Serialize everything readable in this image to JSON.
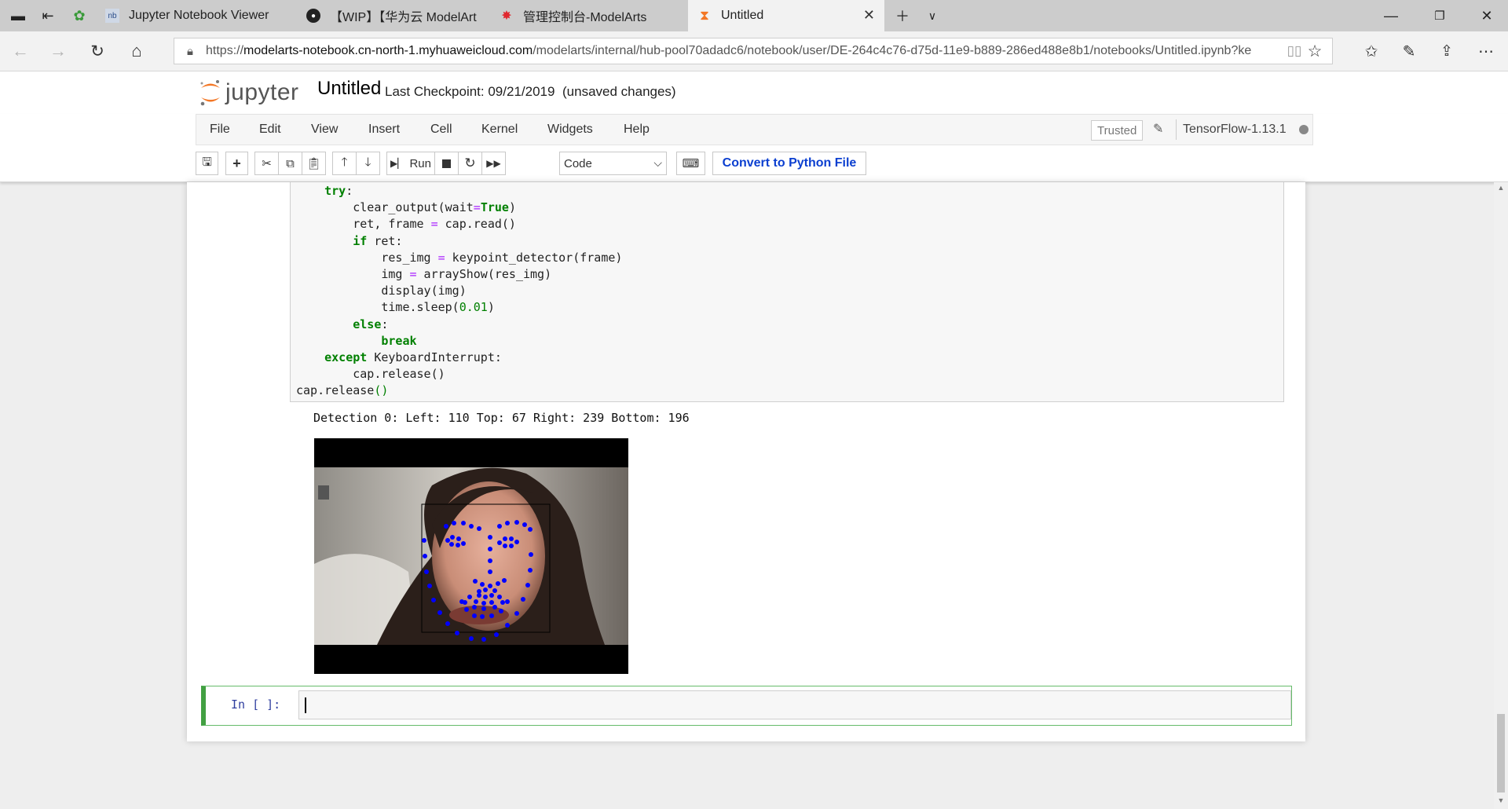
{
  "browser": {
    "tabs": [
      {
        "label": "Jupyter Notebook Viewer",
        "icon": "nbviewer-icon"
      },
      {
        "label": "【WIP】【华为云 ModelArt",
        "icon": "github-icon"
      },
      {
        "label": "管理控制台-ModelArts",
        "icon": "huawei-icon"
      },
      {
        "label": "Untitled",
        "icon": "jupyter-hourglass-icon",
        "active": true
      }
    ],
    "url_scheme": "https://",
    "url_host": "modelarts-notebook.cn-north-1.myhuaweicloud.com",
    "url_path": "/modelarts/internal/hub-pool70adadc6/notebook/user/DE-264c4c76-d75d-11e9-b889-286ed488e8b1/notebooks/Untitled.ipynb?ke"
  },
  "jupyter": {
    "logo_text": "jupyter",
    "notebook_title": "Untitled",
    "checkpoint": "Last Checkpoint: 09/21/2019",
    "unsaved": "(unsaved changes)",
    "menu": [
      "File",
      "Edit",
      "View",
      "Insert",
      "Cell",
      "Kernel",
      "Widgets",
      "Help"
    ],
    "trusted": "Trusted",
    "kernel": "TensorFlow-1.13.1",
    "toolbar": {
      "run_label": "Run",
      "cell_type": "Code",
      "convert_label": "Convert to Python File"
    }
  },
  "cell": {
    "lines": [
      {
        "indent": "    ",
        "tokens": [
          [
            "kw",
            "try"
          ],
          [
            "p",
            ":"
          ]
        ]
      },
      {
        "indent": "        ",
        "tokens": [
          [
            "p",
            "clear_output(wait"
          ],
          [
            "op",
            "="
          ],
          [
            "kw",
            "True"
          ],
          [
            "p",
            ")"
          ]
        ]
      },
      {
        "indent": "        ",
        "tokens": [
          [
            "p",
            "ret, frame "
          ],
          [
            "op",
            "="
          ],
          [
            "p",
            " cap.read()"
          ]
        ]
      },
      {
        "indent": "        ",
        "tokens": [
          [
            "kw",
            "if"
          ],
          [
            "p",
            " ret:"
          ]
        ]
      },
      {
        "indent": "            ",
        "tokens": [
          [
            "p",
            "res_img "
          ],
          [
            "op",
            "="
          ],
          [
            "p",
            " keypoint_detector(frame)"
          ]
        ]
      },
      {
        "indent": "            ",
        "tokens": [
          [
            "p",
            "img "
          ],
          [
            "op",
            "="
          ],
          [
            "p",
            " arrayShow(res_img)"
          ]
        ]
      },
      {
        "indent": "            ",
        "tokens": [
          [
            "p",
            "display(img)"
          ]
        ]
      },
      {
        "indent": "            ",
        "tokens": [
          [
            "p",
            "time.sleep("
          ],
          [
            "num",
            "0.01"
          ],
          [
            "p",
            ")"
          ]
        ]
      },
      {
        "indent": "        ",
        "tokens": [
          [
            "kw",
            "else"
          ],
          [
            "p",
            ":"
          ]
        ]
      },
      {
        "indent": "            ",
        "tokens": [
          [
            "kw",
            "break"
          ]
        ]
      },
      {
        "indent": "    ",
        "tokens": [
          [
            "kw",
            "except"
          ],
          [
            "p",
            " KeyboardInterrupt:"
          ]
        ]
      },
      {
        "indent": "        ",
        "tokens": [
          [
            "p",
            "cap.release()"
          ]
        ]
      },
      {
        "indent": "",
        "tokens": [
          [
            "p",
            "cap.release"
          ],
          [
            "num",
            "()"
          ]
        ]
      }
    ],
    "output_text": "Detection 0: Left: 110 Top: 67 Right: 239 Bottom: 196",
    "new_cell_prompt": "In [ ]:"
  },
  "colors": {
    "keypoint": "#0000ff",
    "keyword": "#008000",
    "operator": "#aa22ff",
    "selected_cell": "#42a042",
    "convert_text": "#0b3fd0"
  }
}
